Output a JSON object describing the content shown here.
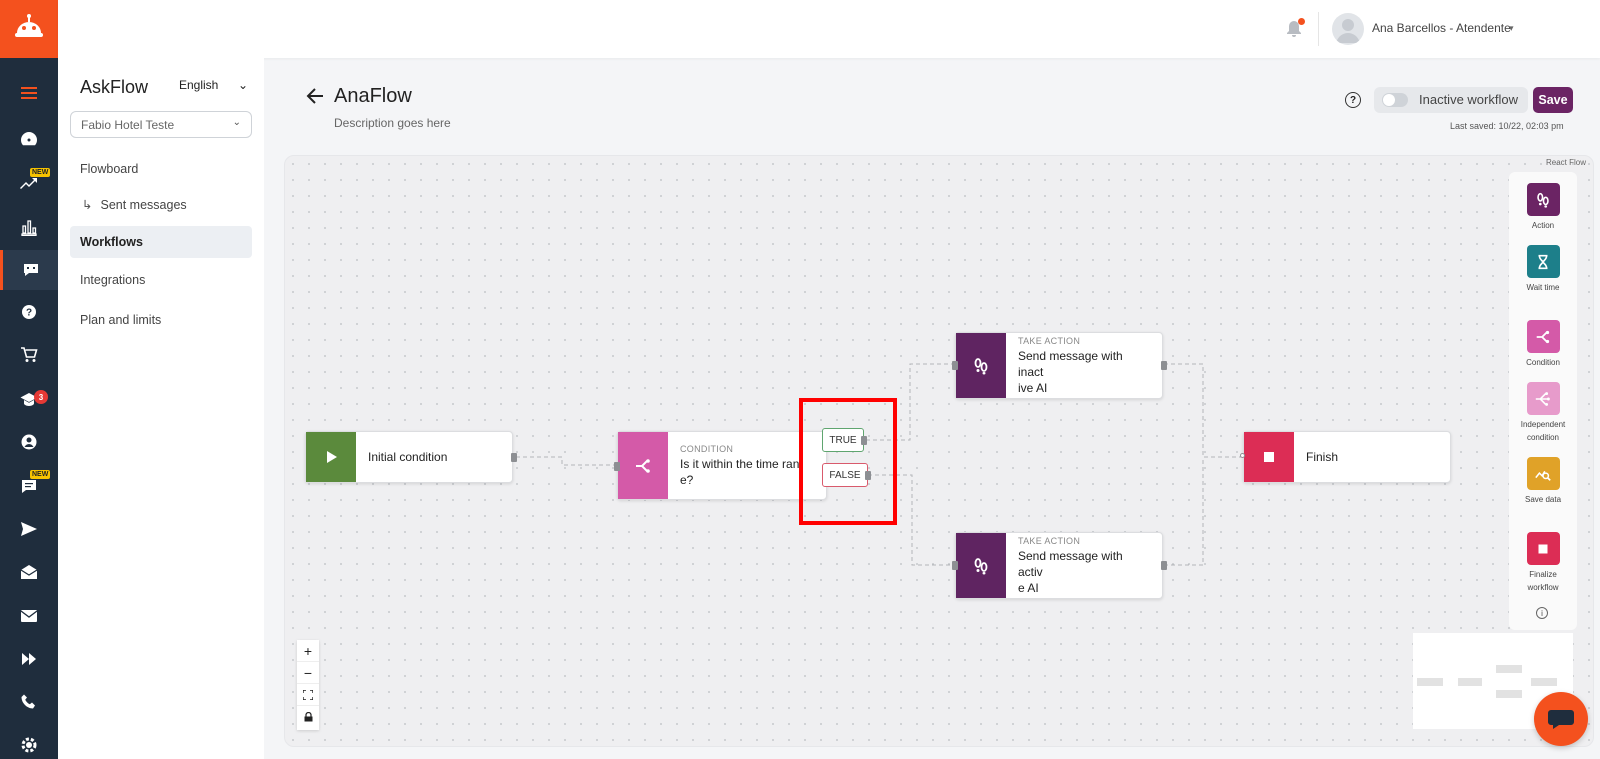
{
  "app": {
    "name": "AskFlow",
    "language": "English",
    "property_select": "Fabio Hotel Teste"
  },
  "topbar": {
    "user": "Ana Barcellos - Atendente",
    "has_notification": true
  },
  "rail": {
    "items": [
      {
        "icon": "hamburger-menu-icon"
      },
      {
        "icon": "dashboard-icon"
      },
      {
        "icon": "trending-chart-icon",
        "badge": "NEW"
      },
      {
        "icon": "bar-chart-icon"
      },
      {
        "icon": "chat-bot-icon",
        "active": true
      },
      {
        "icon": "help-circle-icon"
      },
      {
        "icon": "shopping-cart-icon"
      },
      {
        "icon": "graduation-cap-icon",
        "badge_count": "3"
      },
      {
        "icon": "user-circle-icon"
      },
      {
        "icon": "message-icon",
        "badge": "NEW"
      },
      {
        "icon": "send-icon"
      },
      {
        "icon": "envelope-open-icon"
      },
      {
        "icon": "envelope-icon"
      },
      {
        "icon": "fast-forward-icon"
      },
      {
        "icon": "phone-icon"
      },
      {
        "icon": "settings-icon"
      }
    ]
  },
  "sidebar": {
    "items": [
      {
        "label": "Flowboard"
      },
      {
        "label": "Sent messages",
        "sub": true
      },
      {
        "label": "Workflows",
        "active": true
      },
      {
        "label": "Integrations"
      },
      {
        "label": "Plan and limits"
      }
    ]
  },
  "workflow": {
    "title": "AnaFlow",
    "description": "Description goes here",
    "status_label": "Inactive workflow",
    "active": false,
    "save_label": "Save",
    "last_saved": "Last saved: 10/22, 02:03 pm"
  },
  "canvas": {
    "attribution": "React Flow",
    "nodes": {
      "start": {
        "label": "Initial condition",
        "color": "#5b8a3c"
      },
      "condition": {
        "kicker": "CONDITION",
        "label_line1": "Is it within the time ran",
        "label_line2": "e?",
        "color": "#d45aa8"
      },
      "action_inactive": {
        "kicker": "TAKE ACTION",
        "label_line1": "Send message with inact",
        "label_line2": "ive AI",
        "color": "#5f2461"
      },
      "action_active": {
        "kicker": "TAKE ACTION",
        "label_line1": "Send message with activ",
        "label_line2": "e AI",
        "color": "#5f2461"
      },
      "finish": {
        "label": "Finish",
        "color": "#dc2d55"
      }
    },
    "branches": {
      "true_label": "TRUE",
      "false_label": "FALSE"
    }
  },
  "palette": {
    "items": [
      {
        "label": "Action",
        "color": "#6b2464",
        "icon": "footprints-icon"
      },
      {
        "label": "Wait time",
        "color": "#1d7f8a",
        "icon": "hourglass-icon"
      },
      {
        "label": "Condition",
        "color": "#d45aa8",
        "icon": "branch-icon"
      },
      {
        "label": "Independent condition",
        "color": "#e79bcb",
        "icon": "multi-branch-icon"
      },
      {
        "label": "Save data",
        "color": "#e0a228",
        "icon": "chart-search-icon"
      },
      {
        "label": "Finalize workflow",
        "color": "#dc2d55",
        "icon": "stop-icon"
      }
    ],
    "info_icon": "info-icon"
  },
  "controls": {
    "zoom_in": "+",
    "zoom_out": "−"
  }
}
